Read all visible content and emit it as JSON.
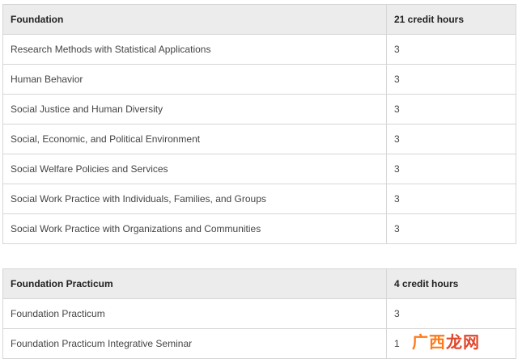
{
  "tables": [
    {
      "header": {
        "name": "Foundation",
        "credits": "21 credit hours"
      },
      "rows": [
        {
          "name": "Research Methods with Statistical Applications",
          "credits": "3"
        },
        {
          "name": "Human Behavior",
          "credits": "3"
        },
        {
          "name": "Social Justice and Human Diversity",
          "credits": "3"
        },
        {
          "name": "Social, Economic, and Political Environment",
          "credits": "3"
        },
        {
          "name": "Social Welfare Policies and Services",
          "credits": "3"
        },
        {
          "name": "Social Work Practice with Individuals, Families, and Groups",
          "credits": "3"
        },
        {
          "name": "Social Work Practice with Organizations and Communities",
          "credits": "3"
        }
      ]
    },
    {
      "header": {
        "name": "Foundation Practicum",
        "credits": "4 credit hours"
      },
      "rows": [
        {
          "name": "Foundation Practicum",
          "credits": "3"
        },
        {
          "name": "Foundation Practicum Integrative Seminar",
          "credits": "1"
        }
      ]
    }
  ],
  "watermark": {
    "part1": "广西",
    "part2": "龙网"
  }
}
